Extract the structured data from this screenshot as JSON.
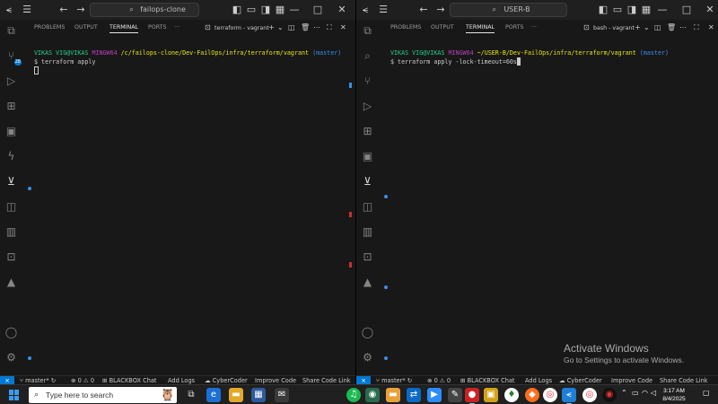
{
  "left": {
    "title_search": "failops-clone",
    "panel_tabs": [
      "PROBLEMS",
      "OUTPUT",
      "TERMINAL",
      "PORTS"
    ],
    "more": "···",
    "terminal_label": "terraform - vagrant",
    "prompt": {
      "user": "VIKAS VIG@VIKAS",
      "shell": "MINGW64",
      "path": "/c/failops-clone/Dev-FailOps/infra/terraform/vagrant",
      "branch": "(master)"
    },
    "command": "$ terraform apply"
  },
  "right": {
    "title_search": "USER-B",
    "panel_tabs": [
      "PROBLEMS",
      "OUTPUT",
      "TERMINAL",
      "PORTS"
    ],
    "more": "···",
    "terminal_label": "bash - vagrant",
    "prompt": {
      "user": "VIKAS VIG@VIKAS",
      "shell": "MINGW64",
      "path": "~/USER-B/Dev-FailOps/infra/terraform/vagrant",
      "branch": "(master)"
    },
    "command": "$ terraform apply -lock-timeout=60s"
  },
  "activity_badge": "28",
  "status": {
    "branch": "master*",
    "problems": "⊗ 0 ⚠ 0",
    "blackbox": "BLACKBOX Chat",
    "addlogs": "Add Logs",
    "cybercoder": "CyberCoder",
    "improve": "Improve Code",
    "share": "Share Code Link"
  },
  "watermark": {
    "line1": "Activate Windows",
    "line2": "Go to Settings to activate Windows."
  },
  "taskbar": {
    "search_placeholder": "Type here to search",
    "time": "3:17 AM",
    "date": "8/4/2025"
  },
  "colors": {
    "accent": "#0078d4",
    "prompt_user": "#23d18b",
    "prompt_shell": "#bc3fbc",
    "prompt_path": "#e5e510",
    "prompt_branch": "#3b8eea"
  }
}
